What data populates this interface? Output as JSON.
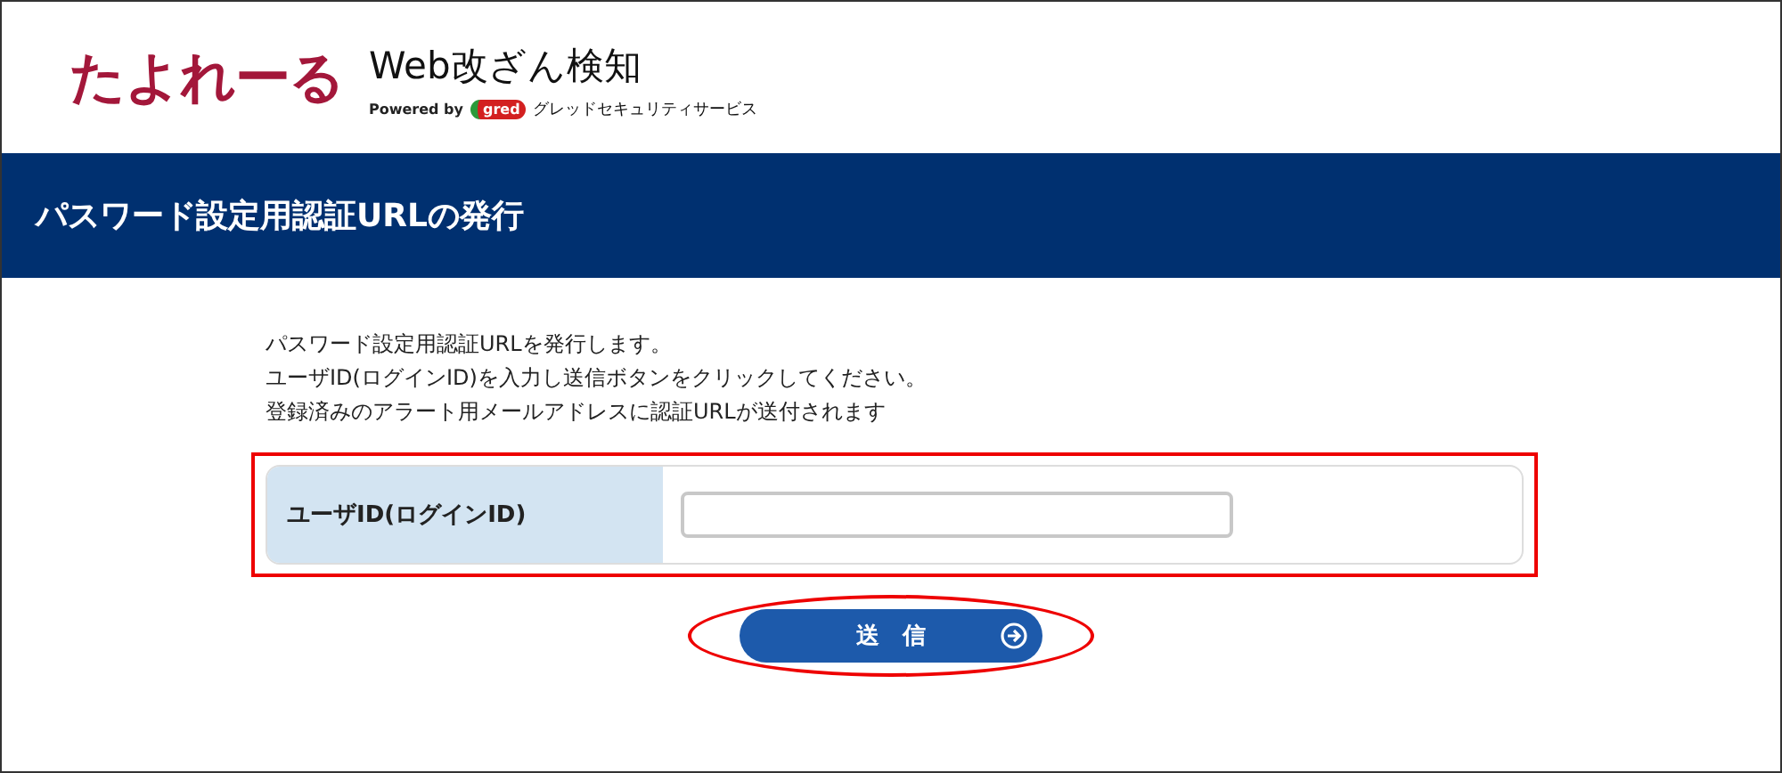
{
  "header": {
    "logo": "たよれーる",
    "product": "Web改ざん検知",
    "powered_by": "Powered by",
    "partner_mark": "gred",
    "partner": "グレッドセキュリティサービス"
  },
  "page_title": "パスワード設定用認証URLの発行",
  "instructions": [
    "パスワード設定用認証URLを発行します。",
    "ユーザID(ログインID)を入力し送信ボタンをクリックしてください。",
    "登録済みのアラート用メールアドレスに認証URLが送付されます"
  ],
  "form": {
    "label": "ユーザID(ログインID)",
    "highlighted": true
  },
  "submit": {
    "label": "送　信",
    "highlighted": true
  }
}
